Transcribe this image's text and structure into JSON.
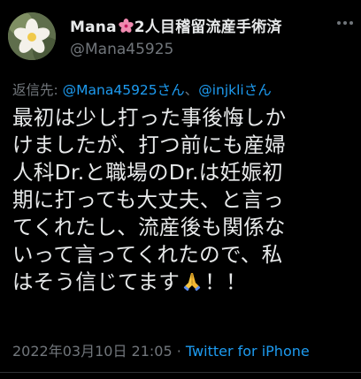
{
  "tweet": {
    "display_name_part1": "Mana",
    "display_name_part2": "2人目稽留流産手術済",
    "handle": "@Mana45925",
    "reply_prefix": "返信先: ",
    "reply_user1": "@Mana45925さん",
    "reply_separator": "、",
    "reply_user2": "@injkliさん",
    "lines": [
      "最初は少し打った事後悔しか",
      "けましたが、打つ前にも産婦",
      "人科Dr.と職場のDr.は妊娠初",
      "期に打っても大丈夫、と言っ",
      "てくれたし、流産後も関係な",
      "いって言ってくれたので、私"
    ],
    "last_line_start": "はそう信じてます",
    "last_line_end": "！！",
    "timestamp": "2022年03月10日 21:05",
    "meta_separator": " · ",
    "source": "Twitter for iPhone",
    "flower_icon": "hibiscus-icon",
    "pray_icon": "folded-hands-icon",
    "colors": {
      "background": "#000000",
      "text": "#e7e9ea",
      "muted": "#71767b",
      "link": "#1d9bf0"
    }
  }
}
